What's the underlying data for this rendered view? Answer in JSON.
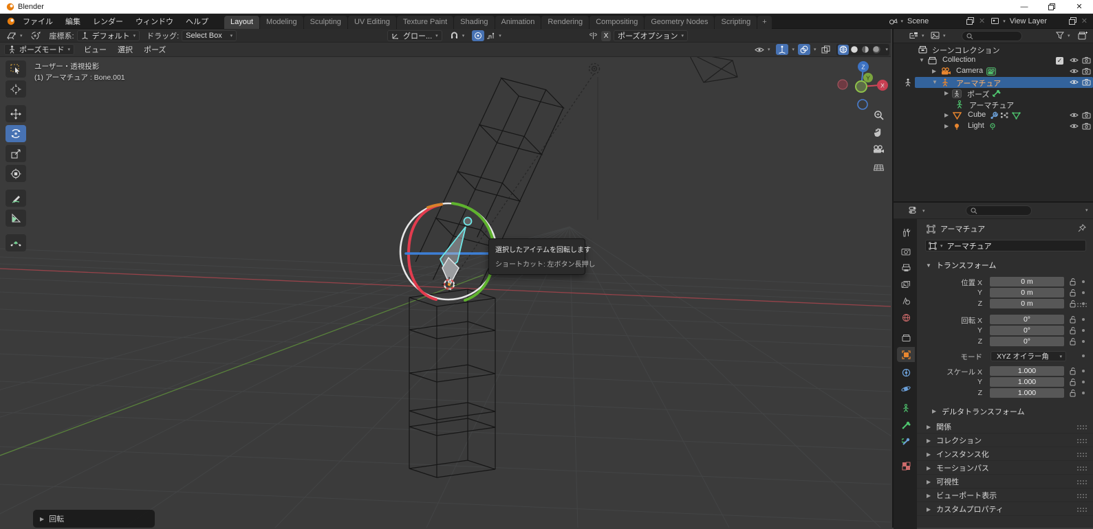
{
  "window": {
    "title": "Blender"
  },
  "menubar": {
    "menus": [
      "ファイル",
      "編集",
      "レンダー",
      "ウィンドウ",
      "ヘルプ"
    ],
    "tabs": [
      "Layout",
      "Modeling",
      "Sculpting",
      "UV Editing",
      "Texture Paint",
      "Shading",
      "Animation",
      "Rendering",
      "Compositing",
      "Geometry Nodes",
      "Scripting",
      "+"
    ],
    "active_tab": "Layout"
  },
  "scene_bar": {
    "scene": "Scene",
    "view_layer": "View Layer"
  },
  "tool_settings": {
    "orientation_label": "座標系:",
    "orientation_value": "デフォルト",
    "drag_label": "ドラッグ:",
    "drag_value": "Select Box",
    "transform_orientation": "グロー...",
    "mirror_x": "X",
    "pose_options": "ポーズオプション"
  },
  "viewport_header": {
    "mode": "ポーズモード",
    "menus": [
      "ビュー",
      "選択",
      "ポーズ"
    ]
  },
  "viewport": {
    "info_line1": "ユーザー・透視投影",
    "info_line2": "(1) アーマチュア : Bone.001",
    "tooltip": {
      "line1": "選択したアイテムを回転します",
      "line2": "ショートカット: 左ボタン長押し"
    },
    "operator_panel": "回転",
    "axis": {
      "x": "X",
      "y": "Y",
      "z": "Z"
    }
  },
  "outliner": {
    "rows": [
      {
        "label": "シーンコレクション"
      },
      {
        "label": "Collection"
      },
      {
        "label": "Camera"
      },
      {
        "label": "アーマチュア"
      },
      {
        "label": "ポーズ"
      },
      {
        "label": "アーマチュア"
      },
      {
        "label": "Cube"
      },
      {
        "label": "Light"
      }
    ]
  },
  "properties": {
    "breadcrumb": "アーマチュア",
    "object_name": "アーマチュア",
    "transform": {
      "title": "トランスフォーム",
      "rows": [
        {
          "label": "位置 X",
          "value": "0 m"
        },
        {
          "label": "Y",
          "value": "0 m"
        },
        {
          "label": "Z",
          "value": "0 m"
        },
        {
          "label": "回転 X",
          "value": "0°"
        },
        {
          "label": "Y",
          "value": "0°"
        },
        {
          "label": "Z",
          "value": "0°"
        },
        {
          "label": "スケール X",
          "value": "1.000"
        },
        {
          "label": "Y",
          "value": "1.000"
        },
        {
          "label": "Z",
          "value": "1.000"
        }
      ],
      "mode_label": "モード",
      "mode_value": "XYZ オイラー角"
    },
    "panels": [
      "デルタトランスフォーム",
      "関係",
      "コレクション",
      "インスタンス化",
      "モーションパス",
      "可視性",
      "ビューポート表示",
      "カスタムプロパティ"
    ]
  },
  "icons": {
    "search": "magnifier",
    "eye": "visibility",
    "camera": "render-visibility",
    "lock": "open-padlock",
    "funnel": "filter",
    "pin": "pin",
    "magnet": "snap",
    "grid": "orthographic-grid"
  },
  "colors": {
    "accent": "#4772b3",
    "selection": "#33639c",
    "active_object_text": "#ffb169",
    "axis_x": "#a8454d",
    "axis_y": "#5f8f3c",
    "gizmo_red": "#e23c4e",
    "gizmo_green": "#5fb32e",
    "gizmo_blue": "#3d7fd6",
    "bone_selected": "#6fe8e8",
    "object_icon": "#e8862f",
    "data_icon": "#4fc66f"
  }
}
